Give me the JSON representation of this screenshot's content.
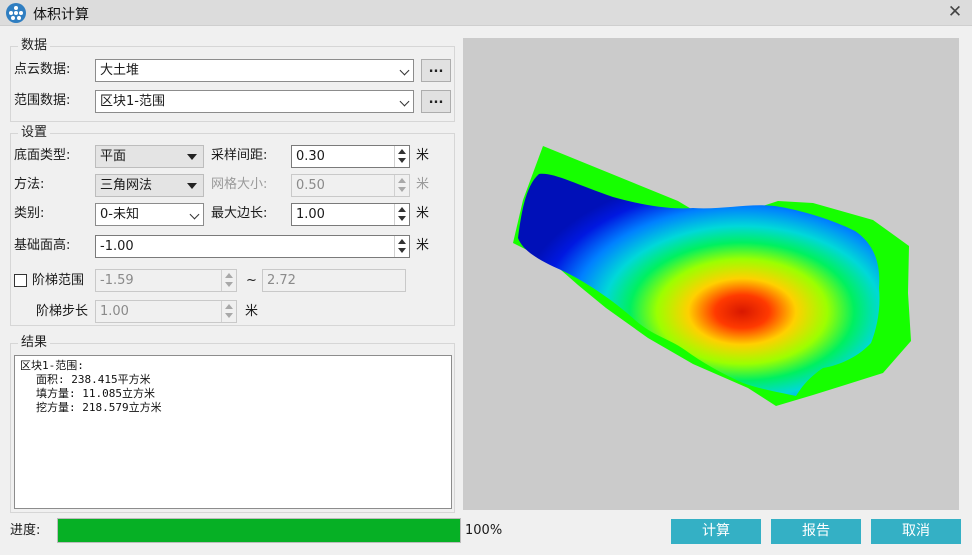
{
  "window": {
    "title": "体积计算",
    "close_glyph": "✕"
  },
  "data_group": {
    "title": "数据",
    "pointcloud": {
      "label": "点云数据:",
      "value": "大土堆",
      "browse": "..."
    },
    "range": {
      "label": "范围数据:",
      "value": "区块1-范围",
      "browse": "..."
    }
  },
  "settings": {
    "title": "设置",
    "base_type": {
      "label": "底面类型:",
      "value": "平面"
    },
    "sample_interval": {
      "label": "采样间距:",
      "value": "0.30",
      "unit": "米"
    },
    "method": {
      "label": "方法:",
      "value": "三角网法"
    },
    "grid_size": {
      "label": "网格大小:",
      "value": "0.50",
      "unit": "米"
    },
    "category": {
      "label": "类别:",
      "value": "0-未知"
    },
    "max_edge": {
      "label": "最大边长:",
      "value": "1.00",
      "unit": "米"
    },
    "base_height": {
      "label": "基础面高:",
      "value": "-1.00",
      "unit": "米"
    },
    "step_range": {
      "label": "阶梯范围",
      "checked": false,
      "from": "-1.59",
      "tilde": "~",
      "to": "2.72"
    },
    "step_size": {
      "label": "阶梯步长",
      "value": "1.00",
      "unit": "米"
    }
  },
  "results": {
    "title": "结果",
    "lines": [
      "区块1-范围:",
      "面积: 238.415平方米",
      "填方量: 11.085立方米",
      "挖方量: 218.579立方米"
    ]
  },
  "progress": {
    "label": "进度:",
    "percent": 100,
    "text": "100%",
    "color": "#06b025"
  },
  "buttons": {
    "compute": "计算",
    "report": "报告",
    "cancel": "取消"
  },
  "colors": {
    "accent": "#34b0c5",
    "preview_bg": "#cbcbcb",
    "fill_area": "#16ff00"
  },
  "icons": {
    "app": "cluster-dots-icon",
    "close": "close-icon"
  }
}
